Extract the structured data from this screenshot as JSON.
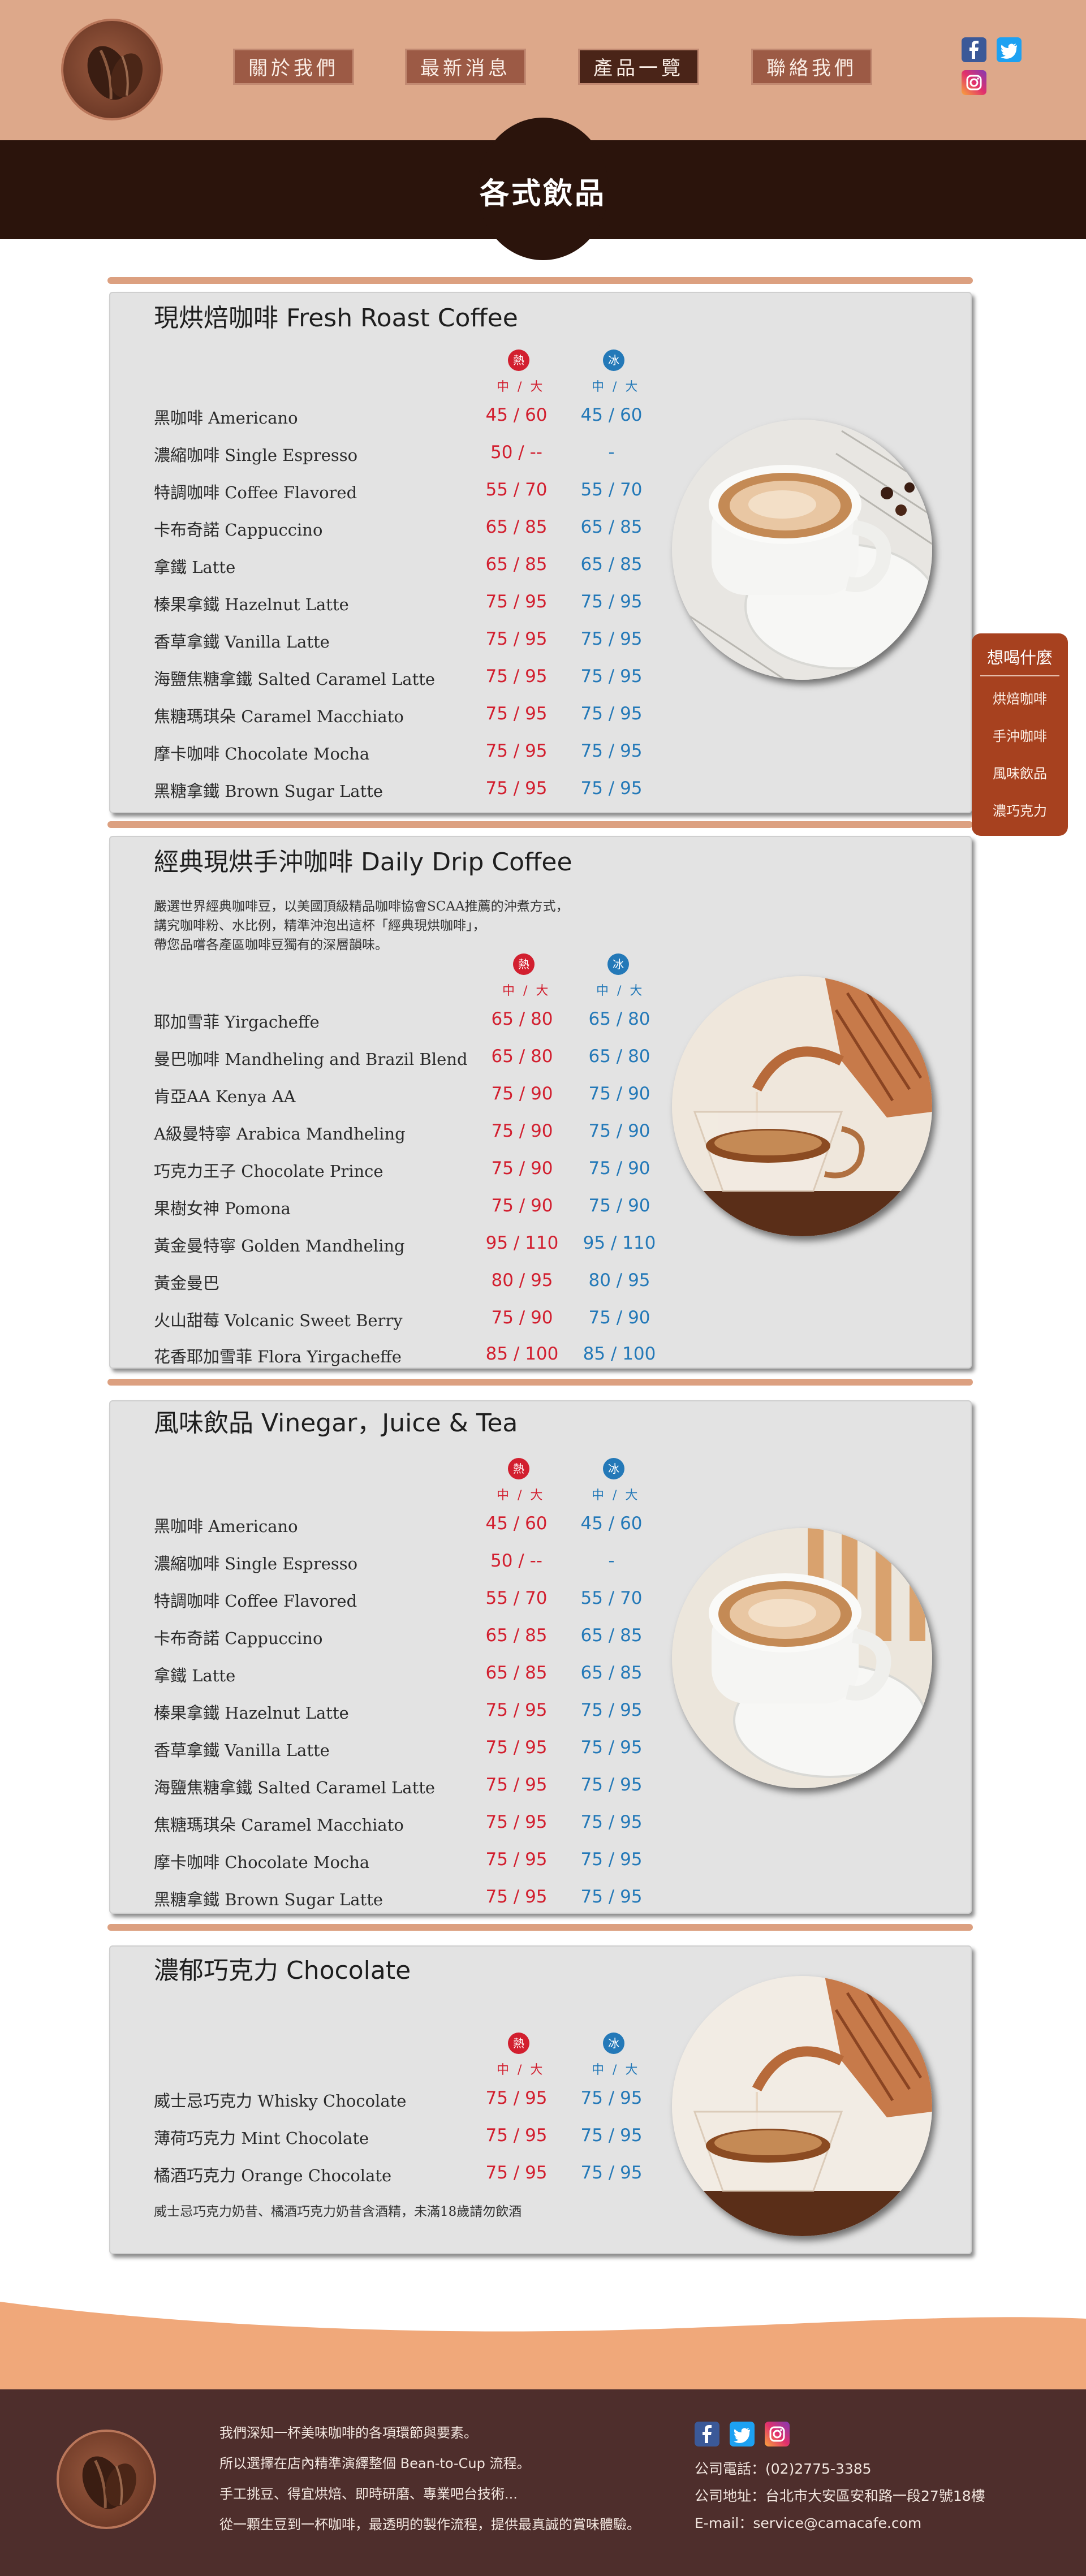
{
  "nav": {
    "items": [
      {
        "label": "關於我們"
      },
      {
        "label": "最新消息"
      },
      {
        "label": "產品一覽"
      },
      {
        "label": "聯絡我們"
      }
    ],
    "active": "產品一覽"
  },
  "page_title": "各式飲品",
  "labels": {
    "hot": "熱",
    "ice": "冰",
    "sizes": "中 / 大"
  },
  "sections": [
    {
      "title": "現烘焙咖啡 Fresh Roast Coffee",
      "items": [
        {
          "name": "黑咖啡 Americano",
          "hot": "45 / 60",
          "ice": "45 / 60"
        },
        {
          "name": "濃縮咖啡 Single Espresso",
          "hot": "50 / --",
          "ice": "-"
        },
        {
          "name": "特調咖啡 Coffee Flavored",
          "hot": "55 / 70",
          "ice": "55 / 70"
        },
        {
          "name": "卡布奇諾 Cappuccino",
          "hot": "65 / 85",
          "ice": "65 / 85"
        },
        {
          "name": "拿鐵 Latte",
          "hot": "65 / 85",
          "ice": "65 / 85"
        },
        {
          "name": "榛果拿鐵 Hazelnut Latte",
          "hot": "75 / 95",
          "ice": "75 / 95"
        },
        {
          "name": "香草拿鐵 Vanilla Latte",
          "hot": "75 / 95",
          "ice": "75 / 95"
        },
        {
          "name": "海鹽焦糖拿鐵 Salted Caramel Latte",
          "hot": "75 / 95",
          "ice": "75 / 95"
        },
        {
          "name": "焦糖瑪琪朵 Caramel Macchiato",
          "hot": "75 / 95",
          "ice": "75 / 95"
        },
        {
          "name": "摩卡咖啡 Chocolate Mocha",
          "hot": "75 / 95",
          "ice": "75 / 95"
        },
        {
          "name": "黑糖拿鐵 Brown Sugar Latte",
          "hot": "75 / 95",
          "ice": "75 / 95"
        }
      ]
    },
    {
      "title": "經典現烘手沖咖啡 Daily Drip Coffee",
      "description": [
        "嚴選世界經典咖啡豆，以美國頂級精品咖啡協會SCAA推薦的沖煮方式，",
        "講究咖啡粉、水比例，精準沖泡出這杯「經典現烘咖啡」，",
        "帶您品嚐各產區咖啡豆獨有的深層韻味。"
      ],
      "items": [
        {
          "name": "耶加雪菲 Yirgacheffe",
          "hot": "65 / 80",
          "ice": "65 / 80"
        },
        {
          "name": "曼巴咖啡 Mandheling and Brazil Blend",
          "hot": "65 / 80",
          "ice": "65 / 80"
        },
        {
          "name": "肯亞AA Kenya AA",
          "hot": "75 / 90",
          "ice": "75 / 90"
        },
        {
          "name": "A級曼特寧 Arabica Mandheling",
          "hot": "75 / 90",
          "ice": "75 / 90"
        },
        {
          "name": "巧克力王子 Chocolate Prince",
          "hot": "75 / 90",
          "ice": "75 / 90"
        },
        {
          "name": "果樹女神 Pomona",
          "hot": "75 / 90",
          "ice": "75 / 90"
        },
        {
          "name": "黃金曼特寧 Golden Mandheling",
          "hot": "95 / 110",
          "ice": "95 / 110"
        },
        {
          "name": "黃金曼巴",
          "hot": "80 / 95",
          "ice": "80 / 95"
        },
        {
          "name": "火山甜莓 Volcanic Sweet Berry",
          "hot": "75 / 90",
          "ice": "75 / 90"
        },
        {
          "name": "花香耶加雪菲 Flora Yirgacheffe",
          "hot": "85 / 100",
          "ice": "85 / 100"
        }
      ]
    },
    {
      "title": "風味飲品 Vinegar，Juice & Tea",
      "items": [
        {
          "name": "黑咖啡 Americano",
          "hot": "45 / 60",
          "ice": "45 / 60"
        },
        {
          "name": "濃縮咖啡 Single Espresso",
          "hot": "50 / --",
          "ice": "-"
        },
        {
          "name": "特調咖啡 Coffee Flavored",
          "hot": "55 / 70",
          "ice": "55 / 70"
        },
        {
          "name": "卡布奇諾 Cappuccino",
          "hot": "65 / 85",
          "ice": "65 / 85"
        },
        {
          "name": "拿鐵 Latte",
          "hot": "65 / 85",
          "ice": "65 / 85"
        },
        {
          "name": "榛果拿鐵 Hazelnut Latte",
          "hot": "75 / 95",
          "ice": "75 / 95"
        },
        {
          "name": "香草拿鐵 Vanilla Latte",
          "hot": "75 / 95",
          "ice": "75 / 95"
        },
        {
          "name": "海鹽焦糖拿鐵 Salted Caramel Latte",
          "hot": "75 / 95",
          "ice": "75 / 95"
        },
        {
          "name": "焦糖瑪琪朵 Caramel Macchiato",
          "hot": "75 / 95",
          "ice": "75 / 95"
        },
        {
          "name": "摩卡咖啡 Chocolate Mocha",
          "hot": "75 / 95",
          "ice": "75 / 95"
        },
        {
          "name": "黑糖拿鐵 Brown Sugar Latte",
          "hot": "75 / 95",
          "ice": "75 / 95"
        }
      ]
    },
    {
      "title": "濃郁巧克力 Chocolate",
      "items": [
        {
          "name": "威士忌巧克力 Whisky Chocolate",
          "hot": "75 / 95",
          "ice": "75 / 95"
        },
        {
          "name": "薄荷巧克力 Mint Chocolate",
          "hot": "75 / 95",
          "ice": "75 / 95"
        },
        {
          "name": "橘酒巧克力 Orange Chocolate",
          "hot": "75 / 95",
          "ice": "75 / 95"
        }
      ],
      "note": "威士忌巧克力奶昔、橘酒巧克力奶昔含酒精，未滿18歲請勿飲酒"
    }
  ],
  "side_menu": {
    "title": "想喝什麼",
    "items": [
      "烘焙咖啡",
      "手沖咖啡",
      "風味飲品",
      "濃巧克力"
    ]
  },
  "footer": {
    "lines": [
      "我們深知一杯美味咖啡的各項環節與要素。",
      "所以選擇在店內精準演繹整個 Bean-to-Cup 流程。",
      "手工挑豆、得宜烘焙、即時研磨、專業吧台技術...",
      "從一顆生豆到一杯咖啡，最透明的製作流程，提供最真誠的賞味體驗。"
    ],
    "phone": "公司電話：(02)2775-3385",
    "address": "公司地址：台北市大安區安和路一段27號18樓",
    "email": "E-mail：service@camacafe.com"
  },
  "colors": {
    "header_bg": "#dda88a",
    "title_band": "#2b140c",
    "hot": "#d21f2f",
    "ice": "#2479b8",
    "footer_bg": "#4e2e2c",
    "side_menu": "#a7411f"
  },
  "icons": {
    "social": [
      "facebook-icon",
      "twitter-icon",
      "instagram-icon"
    ]
  }
}
